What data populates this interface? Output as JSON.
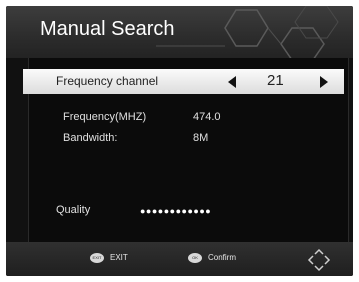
{
  "header": {
    "title": "Manual Search"
  },
  "channel_row": {
    "label": "Frequency channel",
    "value": "21"
  },
  "info": {
    "frequency_label": "Frequency(MHZ)",
    "frequency_value": "474.0",
    "bandwidth_label": "Bandwidth:",
    "bandwidth_value": "8M"
  },
  "quality": {
    "label": "Quality",
    "dots": "●●●●●●●●●●●●"
  },
  "footer": {
    "exit_icon": "EXIT",
    "exit_label": "EXIT",
    "ok_icon": "OK",
    "confirm_label": "Confirm"
  },
  "icons": {
    "header_decoration": "hexagon-pattern-icon",
    "navigation": "dpad-icon"
  },
  "colors": {
    "selected_row": "#f4f4f4",
    "background": "#111111"
  }
}
